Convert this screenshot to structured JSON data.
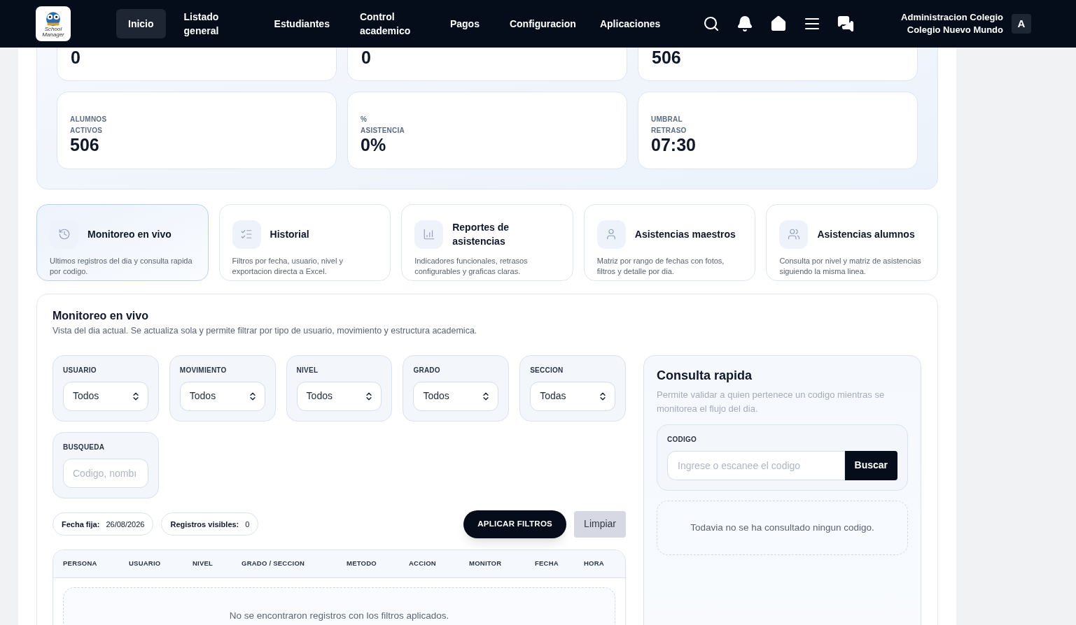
{
  "nav": {
    "logo_text": "School Manager",
    "items": [
      {
        "label": "Inicio",
        "selected": true
      },
      {
        "label": "Listado general",
        "selected": false
      },
      {
        "label": "Estudiantes",
        "selected": false
      },
      {
        "label": "Control academico",
        "selected": false
      },
      {
        "label": "Pagos",
        "selected": false
      },
      {
        "label": "Configuracion",
        "selected": false
      },
      {
        "label": "Aplicaciones",
        "selected": false
      }
    ],
    "icons": [
      {
        "kind": "search"
      },
      {
        "kind": "bell"
      },
      {
        "kind": "home"
      },
      {
        "kind": "menu"
      },
      {
        "kind": "chat"
      }
    ],
    "user": {
      "role": "Administracion Colegio",
      "school": "Colegio Nuevo Mundo",
      "avatar": "A"
    }
  },
  "stats_top": [
    {
      "value": "0"
    },
    {
      "value": "0"
    },
    {
      "value": "506"
    }
  ],
  "stats": [
    {
      "label": "ALUMNOS ACTIVOS",
      "value": "506"
    },
    {
      "label": "% ASISTENCIA",
      "value": "0%"
    },
    {
      "label": "UMBRAL RETRASO",
      "value": "07:30"
    }
  ],
  "modules": [
    {
      "kind": "history",
      "title": "Monitoreo en vivo",
      "description": "Ultimos registros del dia y consulta rapida por codigo.",
      "selected": true
    },
    {
      "kind": "list",
      "title": "Historial",
      "description": "Filtros por fecha, usuario, nivel y exportacion directa a Excel.",
      "selected": false
    },
    {
      "kind": "chart",
      "title": "Reportes de asistencias",
      "description": "Indicadores funcionales, retrasos configurables y graficas claras.",
      "selected": false
    },
    {
      "kind": "user",
      "title": "Asistencias maestros",
      "description": "Matriz por rango de fechas con fotos, filtros y detalle por dia.",
      "selected": false
    },
    {
      "kind": "users",
      "title": "Asistencias alumnos",
      "description": "Consulta por nivel y matriz de asistencias siguiendo la misma linea.",
      "selected": false
    }
  ],
  "monitor": {
    "title": "Monitoreo en vivo",
    "subtitle": "Vista del dia actual. Se actualiza sola y permite filtrar por tipo de usuario, movimiento y estructura academica.",
    "filters": [
      {
        "kind": "select",
        "label": "USUARIO",
        "value": "Todos"
      },
      {
        "kind": "select",
        "label": "MOVIMIENTO",
        "value": "Todos"
      },
      {
        "kind": "select",
        "label": "NIVEL",
        "value": "Todos"
      },
      {
        "kind": "select",
        "label": "GRADO",
        "value": "Todos"
      },
      {
        "kind": "select",
        "label": "SECCION",
        "value": "Todas"
      },
      {
        "kind": "text",
        "label": "BUSQUEDA",
        "placeholder": "Codigo, nombı"
      }
    ],
    "chips": [
      {
        "label": "Fecha fija:",
        "value": "26/08/2026"
      },
      {
        "label": "Registros visibles:",
        "value": "0"
      }
    ],
    "apply_button": "APLICAR FILTROS",
    "clear_button": "Limpiar",
    "table": {
      "columns": [
        "PERSONA",
        "USUARIO",
        "NIVEL",
        "GRADO / SECCION",
        "METODO",
        "ACCION",
        "MONITOR",
        "FECHA",
        "HORA"
      ],
      "empty_message": "No se encontraron registros con los filtros aplicados."
    },
    "quick": {
      "title": "Consulta rapida",
      "description": "Permite validar a quien pertenece un codigo mientras se monitorea el flujo del dia.",
      "field_label": "CODIGO",
      "placeholder": "Ingrese o escanee el codigo",
      "button": "Buscar",
      "empty_message": "Todavia no se ha consultado ningun codigo."
    }
  }
}
